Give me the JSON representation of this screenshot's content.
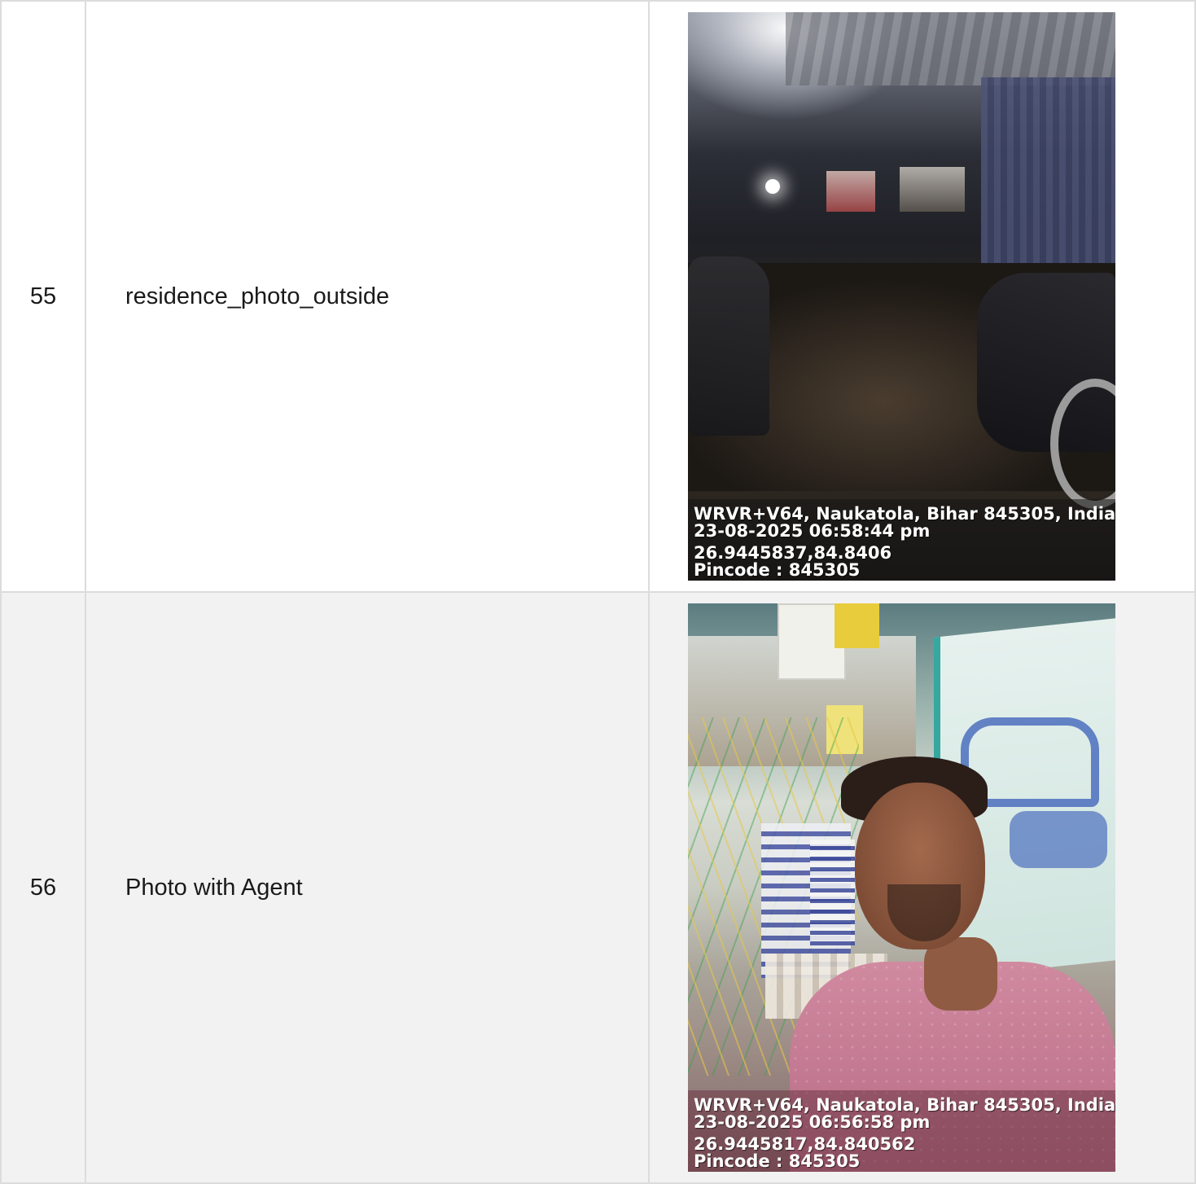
{
  "rows": [
    {
      "number": "55",
      "field": "residence_photo_outside",
      "photo": {
        "caption_lines": [
          "WRVR+V64, Naukatola, Bihar 845305, India .",
          "23-08-2025 06:58:44 pm",
          "26.9445837,84.8406",
          "Pincode : 845305"
        ]
      }
    },
    {
      "number": "56",
      "field": "Photo with Agent",
      "photo": {
        "caption_lines": [
          "WRVR+V64, Naukatola, Bihar 845305, India .",
          "23-08-2025 06:56:58 pm",
          "26.9445817,84.840562",
          "Pincode : 845305"
        ]
      }
    }
  ]
}
